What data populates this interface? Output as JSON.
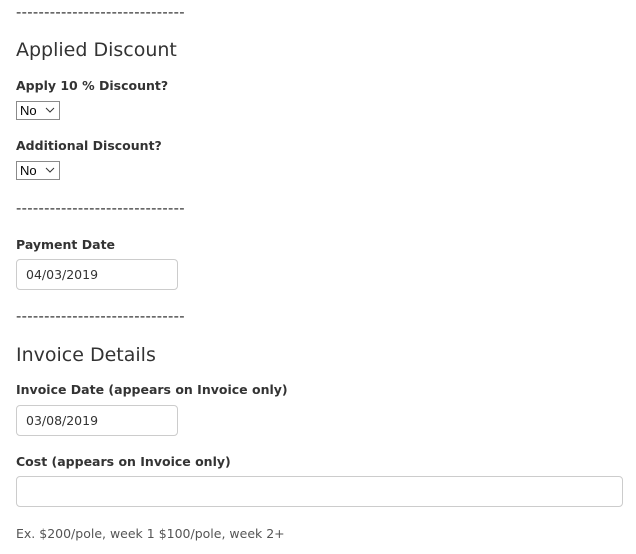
{
  "dividers": {
    "top": "------------------------------",
    "after_discount": "------------------------------",
    "after_payment": "------------------------------"
  },
  "applied_discount": {
    "title": "Applied Discount",
    "apply_10_label": "Apply 10 % Discount?",
    "apply_10_value": "No",
    "additional_label": "Additional Discount?",
    "additional_value": "No"
  },
  "payment": {
    "date_label": "Payment Date",
    "date_value": "04/03/2019"
  },
  "invoice_details": {
    "title": "Invoice Details",
    "date_label": "Invoice Date (appears on Invoice only)",
    "date_value": "03/08/2019",
    "cost_label": "Cost (appears on Invoice only)",
    "cost_value": "",
    "cost_help": "Ex. $200/pole, week 1 $100/pole, week 2+"
  },
  "icons": {
    "select_arrow": "chevron-down-icon"
  }
}
